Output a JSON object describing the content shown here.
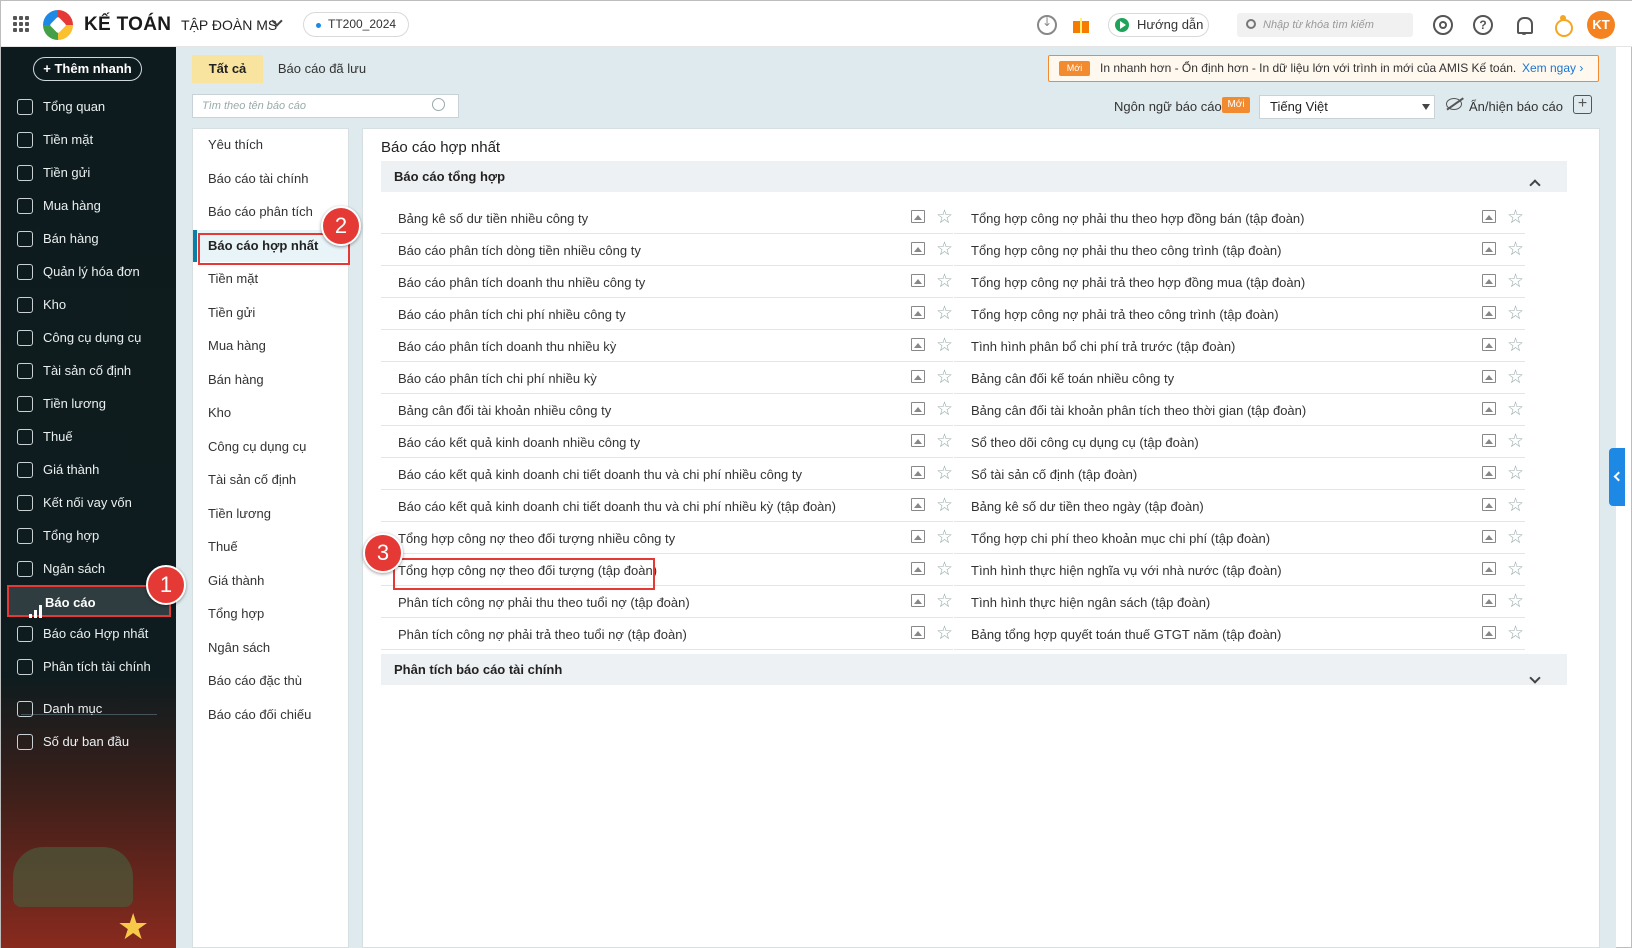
{
  "header": {
    "brand": "KẾ TOÁN",
    "organization": "TẬP ĐOÀN MS",
    "book": "TT200_2024",
    "guide_label": "Hướng dẫn",
    "search_placeholder": "Nhập từ khóa tìm kiếm",
    "avatar_initials": "KT"
  },
  "sidebar": {
    "add_label": "+ Thêm nhanh",
    "items": [
      {
        "label": "Tổng quan",
        "icon": "dashboard-icon"
      },
      {
        "label": "Tiền mặt",
        "icon": "cash-icon"
      },
      {
        "label": "Tiền gửi",
        "icon": "bank-icon"
      },
      {
        "label": "Mua hàng",
        "icon": "purchase-bag-icon"
      },
      {
        "label": "Bán hàng",
        "icon": "cart-icon"
      },
      {
        "label": "Quản lý hóa đơn",
        "icon": "invoice-icon"
      },
      {
        "label": "Kho",
        "icon": "warehouse-icon"
      },
      {
        "label": "Công cụ dụng cụ",
        "icon": "tools-icon"
      },
      {
        "label": "Tài sản cố định",
        "icon": "fixed-asset-icon"
      },
      {
        "label": "Tiền lương",
        "icon": "salary-icon"
      },
      {
        "label": "Thuế",
        "icon": "tax-icon"
      },
      {
        "label": "Giá thành",
        "icon": "price-tag-icon"
      },
      {
        "label": "Kết nối vay vốn",
        "icon": "loan-icon"
      },
      {
        "label": "Tổng hợp",
        "icon": "summary-icon"
      },
      {
        "label": "Ngân sách",
        "icon": "budget-icon"
      },
      {
        "label": "Báo cáo",
        "icon": "report-bars-icon",
        "active": true
      },
      {
        "label": "Báo cáo Hợp nhất",
        "icon": "consolidated-report-icon"
      },
      {
        "label": "Phân tích tài chính",
        "icon": "analysis-icon"
      },
      {
        "label": "Danh mục",
        "icon": "list-icon"
      },
      {
        "label": "Số dư ban đầu",
        "icon": "opening-balance-icon"
      }
    ]
  },
  "tabs": {
    "all": "Tất cả",
    "saved": "Báo cáo đã lưu"
  },
  "notice": {
    "badge": "Mới",
    "text": "In nhanh hơn - Ổn định hơn - In dữ liệu lớn với trình in mới của AMIS Kế toán.",
    "link": "Xem ngay ›"
  },
  "toolbar": {
    "search_placeholder": "Tìm theo tên báo cáo",
    "lang_label": "Ngôn ngữ báo cáo",
    "lang_new": "Mới",
    "lang_value": "Tiếng Việt",
    "toggle_label": "Ẩn/hiện báo cáo"
  },
  "categories": [
    "Yêu thích",
    "Báo cáo tài chính",
    "Báo cáo phân tích",
    "Báo cáo hợp nhất",
    "Tiền mặt",
    "Tiền gửi",
    "Mua hàng",
    "Bán hàng",
    "Kho",
    "Công cụ dụng cụ",
    "Tài sản cố định",
    "Tiền lương",
    "Thuế",
    "Giá thành",
    "Tổng hợp",
    "Ngân sách",
    "Báo cáo đặc thù",
    "Báo cáo đối chiếu"
  ],
  "reports": {
    "title": "Báo cáo hợp nhất",
    "group1": "Báo cáo tổng hợp",
    "group2": "Phân tích báo cáo tài chính",
    "left": [
      "Bảng kê số dư tiền nhiều công ty",
      "Báo cáo phân tích dòng tiền nhiều công ty",
      "Báo cáo phân tích doanh thu nhiều công ty",
      "Báo cáo phân tích chi phí nhiều công ty",
      "Báo cáo phân tích doanh thu nhiều kỳ",
      "Báo cáo phân tích chi phí nhiều kỳ",
      "Bảng cân đối tài khoản nhiều công ty",
      "Báo cáo kết quả kinh doanh nhiều công ty",
      "Báo cáo kết quả kinh doanh chi tiết doanh thu và chi phí nhiều công ty",
      "Báo cáo kết quả kinh doanh chi tiết doanh thu và chi phí nhiều kỳ (tập đoàn)",
      "Tổng hợp công nợ theo đối tượng nhiều công ty",
      "Tổng hợp công nợ theo đối tượng (tập đoàn)",
      "Phân tích công nợ phải thu theo tuổi nợ (tập đoàn)",
      "Phân tích công nợ phải trả theo tuổi nợ (tập đoàn)"
    ],
    "right": [
      "Tổng hợp công nợ phải thu theo hợp đồng bán (tập đoàn)",
      "Tổng hợp công nợ phải thu theo công trình (tập đoàn)",
      "Tổng hợp công nợ phải trả theo hợp đồng mua (tập đoàn)",
      "Tổng hợp công nợ phải trả theo công trình (tập đoàn)",
      "Tình hình phân bổ chi phí trả trước (tập đoàn)",
      "Bảng cân đối kế toán nhiều công ty",
      "Bảng cân đối tài khoản phân tích theo thời gian (tập đoàn)",
      "Sổ theo dõi công cụ dụng cụ (tập đoàn)",
      "Sổ tài sản cố định (tập đoàn)",
      "Bảng kê số dư tiền theo ngày (tập đoàn)",
      "Tổng hợp chi phí theo khoản mục chi phí (tập đoàn)",
      "Tình hình thực hiện nghĩa vụ với nhà nước (tập đoàn)",
      "Tình hình thực hiện ngân sách (tập đoàn)",
      "Bảng tổng hợp quyết toán thuế GTGT năm (tập đoàn)"
    ]
  },
  "callouts": {
    "one": "1",
    "two": "2",
    "three": "3"
  },
  "colors": {
    "accent": "#0a7fa8",
    "highlight": "#e53935",
    "tab_active": "#f9e49f",
    "sidebar_bg": "#0d1b1e",
    "notice": "#f28b30"
  }
}
